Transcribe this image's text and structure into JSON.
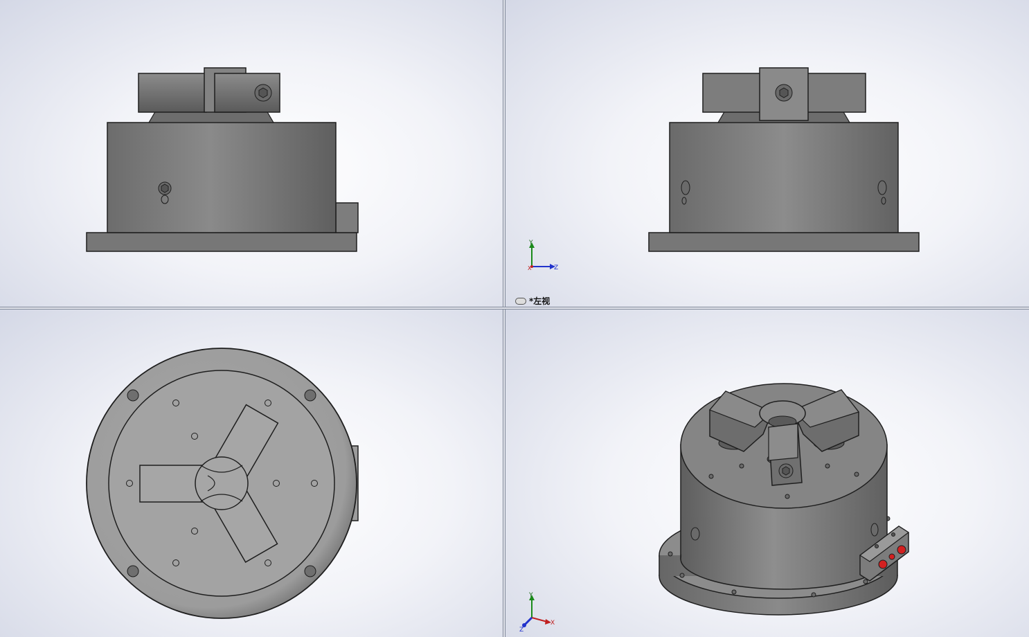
{
  "viewports": {
    "top_left": {
      "name": "front-view"
    },
    "top_right": {
      "name": "left-view",
      "label": "*左视",
      "triad": {
        "y": "Y",
        "z": "Z",
        "x": "X"
      }
    },
    "bottom_left": {
      "name": "bottom-view"
    },
    "bottom_right": {
      "name": "isometric-view",
      "triad": {
        "y": "Y",
        "x": "X",
        "z": "Z"
      }
    }
  },
  "colors": {
    "body": "#7a7a7a",
    "body_dark": "#5e5e5e",
    "edge": "#1e1e1e",
    "port_red": "#d42020"
  }
}
